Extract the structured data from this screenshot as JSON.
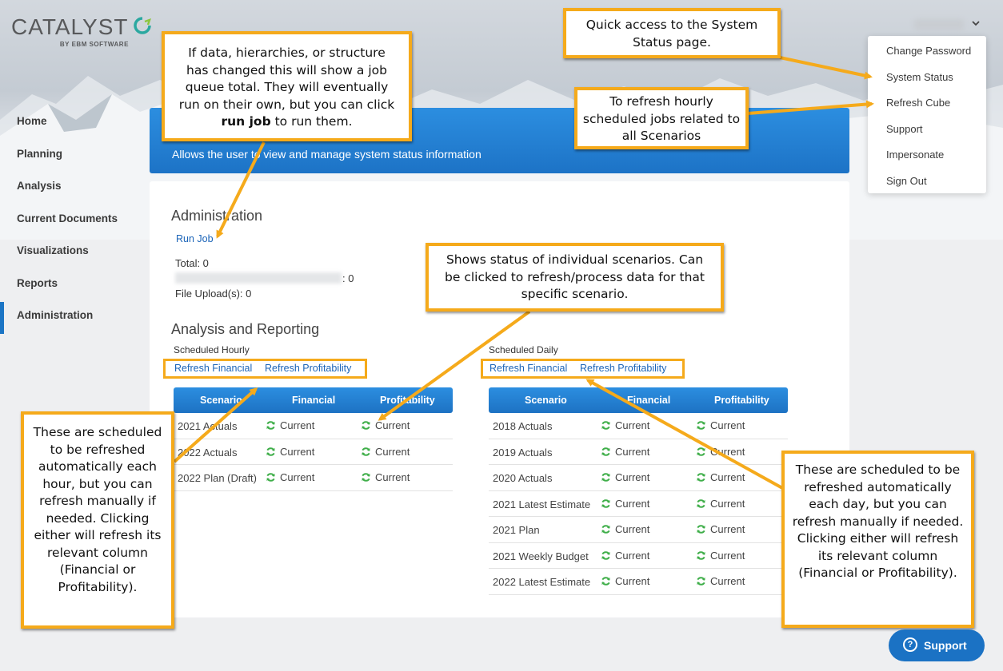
{
  "app": {
    "brand": "CATALYST",
    "sub": "BY EBM SOFTWARE"
  },
  "nav": {
    "items": [
      {
        "label": "Home"
      },
      {
        "label": "Planning"
      },
      {
        "label": "Analysis"
      },
      {
        "label": "Current Documents"
      },
      {
        "label": "Visualizations"
      },
      {
        "label": "Reports"
      },
      {
        "label": "Administration",
        "active": true
      }
    ]
  },
  "user_menu": {
    "items": [
      "Change Password",
      "System Status",
      "Refresh Cube",
      "Support",
      "Impersonate",
      "Sign Out"
    ]
  },
  "banner": {
    "description": "Allows the user to view and manage system status information"
  },
  "administration": {
    "heading": "Administration",
    "run_job": "Run Job",
    "total": "Total: 0",
    "blurred_value": ": 0",
    "file_uploads": "File Upload(s): 0"
  },
  "analysis_reporting": {
    "heading": "Analysis and Reporting",
    "hourly": {
      "title": "Scheduled Hourly",
      "refresh_financial": "Refresh Financial",
      "refresh_profitability": "Refresh Profitability",
      "columns": [
        "Scenario",
        "Financial",
        "Profitability"
      ],
      "rows": [
        {
          "scenario": "2021 Actuals",
          "financial": "Current",
          "profitability": "Current"
        },
        {
          "scenario": "2022 Actuals",
          "financial": "Current",
          "profitability": "Current"
        },
        {
          "scenario": "2022 Plan (Draft)",
          "financial": "Current",
          "profitability": "Current"
        }
      ]
    },
    "daily": {
      "title": "Scheduled Daily",
      "refresh_financial": "Refresh Financial",
      "refresh_profitability": "Refresh Profitability",
      "columns": [
        "Scenario",
        "Financial",
        "Profitability"
      ],
      "rows": [
        {
          "scenario": "2018 Actuals",
          "financial": "Current",
          "profitability": "Current"
        },
        {
          "scenario": "2019 Actuals",
          "financial": "Current",
          "profitability": "Current"
        },
        {
          "scenario": "2020 Actuals",
          "financial": "Current",
          "profitability": "Current"
        },
        {
          "scenario": "2021 Latest Estimate",
          "financial": "Current",
          "profitability": "Current"
        },
        {
          "scenario": "2021 Plan",
          "financial": "Current",
          "profitability": "Current"
        },
        {
          "scenario": "2021 Weekly Budget",
          "financial": "Current",
          "profitability": "Current"
        },
        {
          "scenario": "2022 Latest Estimate",
          "financial": "Current",
          "profitability": "Current"
        }
      ]
    }
  },
  "callouts": {
    "system_status_pre": "Quick access to the System Status page.",
    "refresh_cube": "To refresh hourly scheduled jobs related to all Scenarios",
    "job_queue_pre": "If data, hierarchies, or structure has changed this will show a job queue total. They will eventually run on their own, but you can click ",
    "job_queue_bold": "run job",
    "job_queue_post": " to run them.",
    "scenario_status": "Shows status of individual scenarios. Can be clicked to refresh/process data for that specific scenario.",
    "hourly_note": "These are scheduled to be refreshed automatically each hour, but you can refresh manually if needed. Clicking either will refresh its relevant column (Financial or Profitability).",
    "daily_note": "These are scheduled to be refreshed automatically each day, but you can refresh manually if needed. Clicking either will refresh its relevant column (Financial or Profitability)."
  },
  "support_button": {
    "label": "Support",
    "icon": "question-circle-icon"
  },
  "colors": {
    "accent": "#1d73c6",
    "callout_border": "#f5aa1b",
    "status_icon": "#3fae49"
  }
}
